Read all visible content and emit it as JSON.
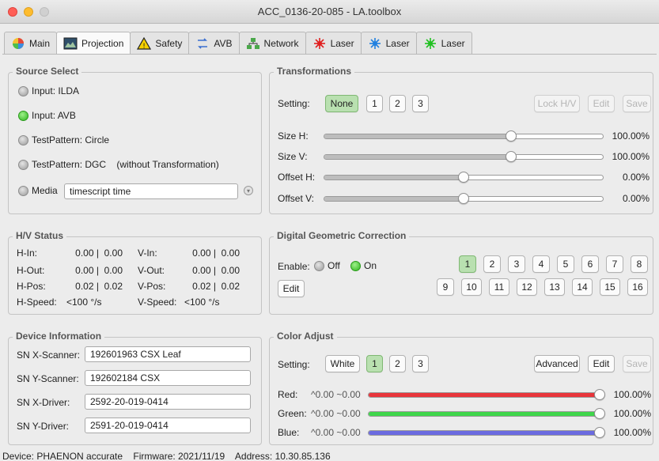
{
  "window": {
    "title": "ACC_0136-20-085  -  LA.toolbox"
  },
  "tabs": [
    {
      "label": "Main",
      "icon": "color-wheel-icon"
    },
    {
      "label": "Projection",
      "icon": "projection-image-icon"
    },
    {
      "label": "Safety",
      "icon": "warning-triangle-icon"
    },
    {
      "label": "AVB",
      "icon": "avb-arrows-icon"
    },
    {
      "label": "Network",
      "icon": "network-icon"
    },
    {
      "label": "Laser",
      "icon": "red-laser-icon",
      "color": "#e02020"
    },
    {
      "label": "Laser",
      "icon": "blue-laser-icon",
      "color": "#2080e0"
    },
    {
      "label": "Laser",
      "icon": "green-laser-icon",
      "color": "#20c020"
    }
  ],
  "source_select": {
    "title": "Source Select",
    "options": [
      "Input: ILDA",
      "Input: AVB",
      "TestPattern: Circle",
      "TestPattern: DGC    (without Transformation)"
    ],
    "active_index": 1,
    "media_label": "Media",
    "media_value": "timescript time"
  },
  "transformations": {
    "title": "Transformations",
    "setting_label": "Setting:",
    "buttons": [
      "None",
      "1",
      "2",
      "3"
    ],
    "lock_label": "Lock H/V",
    "edit_label": "Edit",
    "save_label": "Save",
    "sliders": [
      {
        "label": "Size H:",
        "value": "100.00%",
        "level": 0.67
      },
      {
        "label": "Size V:",
        "value": "100.00%",
        "level": 0.67
      },
      {
        "label": "Offset H:",
        "value": "0.00%",
        "level": 0.5
      },
      {
        "label": "Offset V:",
        "value": "0.00%",
        "level": 0.5
      }
    ]
  },
  "hv_status": {
    "title": "H/V Status",
    "rows": [
      {
        "l1": "H-In:",
        "v1": "0.00 |  0.00",
        "l2": "V-In:",
        "v2": "0.00 |  0.00"
      },
      {
        "l1": "H-Out:",
        "v1": "0.00 |  0.00",
        "l2": "V-Out:",
        "v2": "0.00 |  0.00"
      },
      {
        "l1": "H-Pos:",
        "v1": "0.02 |  0.02",
        "l2": "V-Pos:",
        "v2": "0.02 |  0.02"
      }
    ],
    "speed": {
      "h_label": "H-Speed:",
      "h_value": "<100 °/s",
      "v_label": "V-Speed:",
      "v_value": "<100 °/s"
    }
  },
  "dgc": {
    "title": "Digital Geometric Correction",
    "enable_label": "Enable:",
    "off_label": "Off",
    "on_label": "On",
    "edit_label": "Edit",
    "buttons_row1": [
      "1",
      "2",
      "3",
      "4",
      "5",
      "6",
      "7",
      "8"
    ],
    "buttons_row2": [
      "9",
      "10",
      "11",
      "12",
      "13",
      "14",
      "15",
      "16"
    ]
  },
  "device_info": {
    "title": "Device Information",
    "fields": [
      {
        "label": "SN X-Scanner:",
        "value": "192601963 CSX Leaf"
      },
      {
        "label": "SN Y-Scanner:",
        "value": "192602184 CSX"
      },
      {
        "label": "SN X-Driver:",
        "value": "2592-20-019-0414"
      },
      {
        "label": "SN Y-Driver:",
        "value": "2591-20-019-0414"
      }
    ]
  },
  "color_adjust": {
    "title": "Color Adjust",
    "setting_label": "Setting:",
    "buttons": [
      "White",
      "1",
      "2",
      "3"
    ],
    "advanced_label": "Advanced",
    "edit_label": "Edit",
    "save_label": "Save",
    "channels": [
      {
        "label": "Red:",
        "meta": "^0.00 ~0.00",
        "value": "100.00%",
        "color": "#e8353b"
      },
      {
        "label": "Green:",
        "meta": "^0.00 ~0.00",
        "value": "100.00%",
        "color": "#3fd64b"
      },
      {
        "label": "Blue:",
        "meta": "^0.00 ~0.00",
        "value": "100.00%",
        "color": "#6b6be0"
      }
    ]
  },
  "status_bar": {
    "text": "Device: PHAENON accurate    Firmware: 2021/11/19    Address: 10.30.85.136"
  }
}
